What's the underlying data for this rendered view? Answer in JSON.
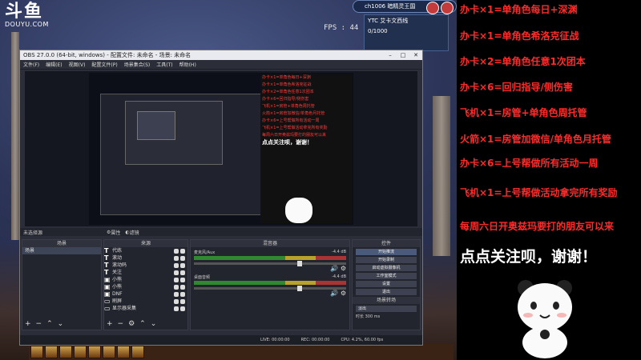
{
  "stream": {
    "platform_logo_main": "斗鱼",
    "platform_logo_sub": "DOUYU.COM",
    "fps_label": "FPS : 44"
  },
  "game_hud": {
    "top_text": "ch1006 暗精灵王国",
    "mini_title": "YTC  艾卡文西线",
    "mini_sub": "0/1000"
  },
  "obs": {
    "title": "OBS 27.0.0 (64-bit, windows) - 配置文件: 未命名 - 场景: 未命名",
    "menu": [
      "文件(F)",
      "编辑(E)",
      "视图(V)",
      "配置文件(P)",
      "场景集合(S)",
      "工具(T)",
      "帮助(H)"
    ],
    "source_selected_label": "未选择源",
    "props_button": "属性",
    "filter_button": "滤镜",
    "docks": {
      "scenes_header": "场景",
      "sources_header": "来源",
      "mixer_header": "混音器",
      "controls_header": "控件"
    },
    "scenes": [
      "场景"
    ],
    "sources": [
      {
        "type": "T",
        "name": "代练"
      },
      {
        "type": "T",
        "name": "滚动"
      },
      {
        "type": "T",
        "name": "滚动码"
      },
      {
        "type": "T",
        "name": "关注"
      },
      {
        "type": "T",
        "name": "小熊"
      },
      {
        "type": "T",
        "name": "小熊"
      },
      {
        "type": "img",
        "name": "DNF"
      },
      {
        "type": "img",
        "name": "刷屏"
      },
      {
        "type": "img",
        "name": "显示器采集"
      }
    ],
    "mixer": [
      {
        "name": "麦克风/Aux",
        "db": "-4.4 dB"
      },
      {
        "name": "桌面音频",
        "db": "-4.4 dB"
      }
    ],
    "controls": [
      "开始推流",
      "开始录制",
      "启动虚拟摄像机",
      "工作室模式",
      "设置",
      "退出"
    ],
    "transition_header": "场景转场",
    "transition_value": "淡出",
    "duration_label": "时长",
    "duration_value": "300 ms",
    "status": {
      "live": "LIVE: 00:00:00",
      "rec": "REC: 00:00:00",
      "cpu": "CPU: 4.2%, 60.00 fps"
    },
    "preview_lines": [
      "办卡×1=单角色每日+深渊",
      "办卡×1=单角色希洛克征战",
      "办卡×2=单角色任意1次团本",
      "办卡×6=回归指导/侧伤害",
      "飞机×1=房管+单角色周托管",
      "火箭×1=房管加微信/单角色月托管",
      "办卡×6=上号帮做所有活动一周",
      "飞机×1=上号帮做活动拿完所有奖励",
      "每周六日开奥兹玛要打的朋友可以来"
    ],
    "preview_big": "点点关注呗，谢谢！"
  },
  "side_panel": {
    "lines": [
      "办卡×1=单角色每日+深渊",
      "办卡×1=单角色希洛克征战",
      "办卡×2=单角色任意1次团本",
      "办卡×6=回归指导/侧伤害",
      "飞机×1=房管+单角色周托管",
      "火箭×1=房管加微信/单角色月托管",
      "办卡×6=上号帮做所有活动一周",
      "飞机×1=上号帮做活动拿完所有奖励",
      "每周六日开奥兹玛要打的朋友可以来"
    ],
    "big_text": "点点关注呗，谢谢！",
    "text_color": "#ff2a2a"
  }
}
